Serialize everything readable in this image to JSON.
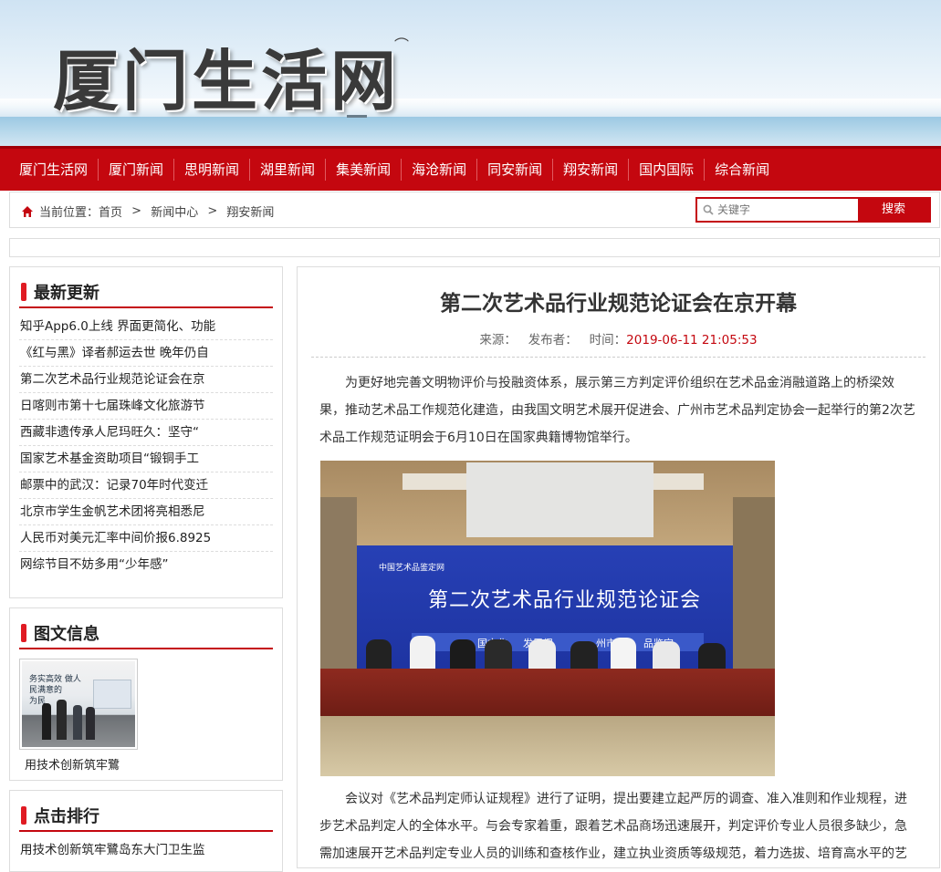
{
  "header": {
    "logo_text": "厦门生活网"
  },
  "nav": {
    "items": [
      "厦门生活网",
      "厦门新闻",
      "思明新闻",
      "湖里新闻",
      "集美新闻",
      "海沧新闻",
      "同安新闻",
      "翔安新闻",
      "国内国际",
      "综合新闻"
    ]
  },
  "breadcrumb": {
    "prefix": "当前位置：",
    "items": [
      "首页",
      "新闻中心",
      "翔安新闻"
    ],
    "separator": " > "
  },
  "search": {
    "placeholder": "关键字",
    "button_label": "搜索"
  },
  "latest": {
    "title": "最新更新",
    "items": [
      "知乎App6.0上线 界面更简化、功能",
      "《红与黑》译者郝运去世 晚年仍自",
      "第二次艺术品行业规范论证会在京",
      "日喀则市第十七届珠峰文化旅游节",
      "西藏非遗传承人尼玛旺久：坚守“",
      "国家艺术基金资助项目“锻铜手工",
      "邮票中的武汉：记录70年时代变迁",
      "北京市学生金帆艺术团将亮相悉尼",
      "人民币对美元汇率中间价报6.8925",
      "网综节目不妨多用“少年感”"
    ]
  },
  "photo_news": {
    "title": "图文信息",
    "caption": "用技术创新筑牢鷺",
    "thumb_sign_text": "务实高效 做人民满意的",
    "thumb_sign_text2": "为民"
  },
  "ranking": {
    "title": "点击排行",
    "items": [
      "用技术创新筑牢鷺岛东大门卫生监"
    ]
  },
  "article": {
    "title": "第二次艺术品行业规范论证会在京开幕",
    "source_label": "来源：",
    "publisher_label": "发布者：",
    "time_label": "时间：",
    "time_value": "2019-06-11 21:05:53",
    "paragraph1": "为更好地完善文明物评价与投融资体系，展示第三方判定评价组织在艺术品金消融道路上的桥梁效果，推动艺术品工作规范化建造，由我国文明艺术展开促进会、广州市艺术品判定协会一起举行的第2次艺术品工作规范证明会于6月10日在国家典籍博物馆举行。",
    "paragraph2": "会议对《艺术品判定师认证规程》进行了证明，提出要建立起严厉的调查、准入准则和作业规程，进步艺术品判定人的全体水平。与会专家着重，跟着艺术品商场迅速展开，判定评价专业人员很多缺少，急需加速展开艺术品判定专业人员的训练和查核作业，建立执业资质等级规范，着力选拔、培育高水平的艺",
    "photo": {
      "backdrop_logo": "中国艺术品鉴定网",
      "backdrop_title": "第二次艺术品行业规范论证会",
      "backdrop_sub1": "国文化",
      "backdrop_sub2": "发展促",
      "backdrop_sub3": "州市艺",
      "backdrop_sub4": "品鉴定"
    }
  }
}
